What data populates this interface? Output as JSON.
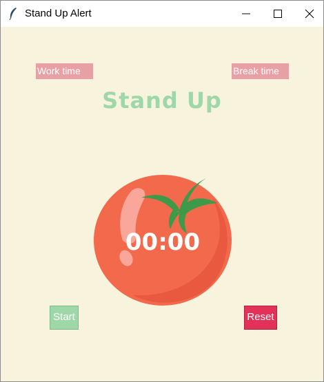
{
  "window": {
    "title": "Stand Up Alert",
    "icons": {
      "app": "feather-icon",
      "minimize": "minimize-icon",
      "maximize": "maximize-icon",
      "close": "close-icon"
    }
  },
  "labels": {
    "work_time": "Work time",
    "break_time": "Break time"
  },
  "heading": "Stand Up",
  "timer": {
    "display": "00:00",
    "image": "tomato-icon"
  },
  "buttons": {
    "start": "Start",
    "reset": "Reset"
  },
  "colors": {
    "background": "#f7f3dd",
    "label_bg": "#e7a0a6",
    "heading": "#9fd8a8",
    "start_bg": "#9fd8a8",
    "reset_bg": "#e3325a",
    "tomato": "#f26a4b",
    "leaf": "#3e9a48"
  }
}
